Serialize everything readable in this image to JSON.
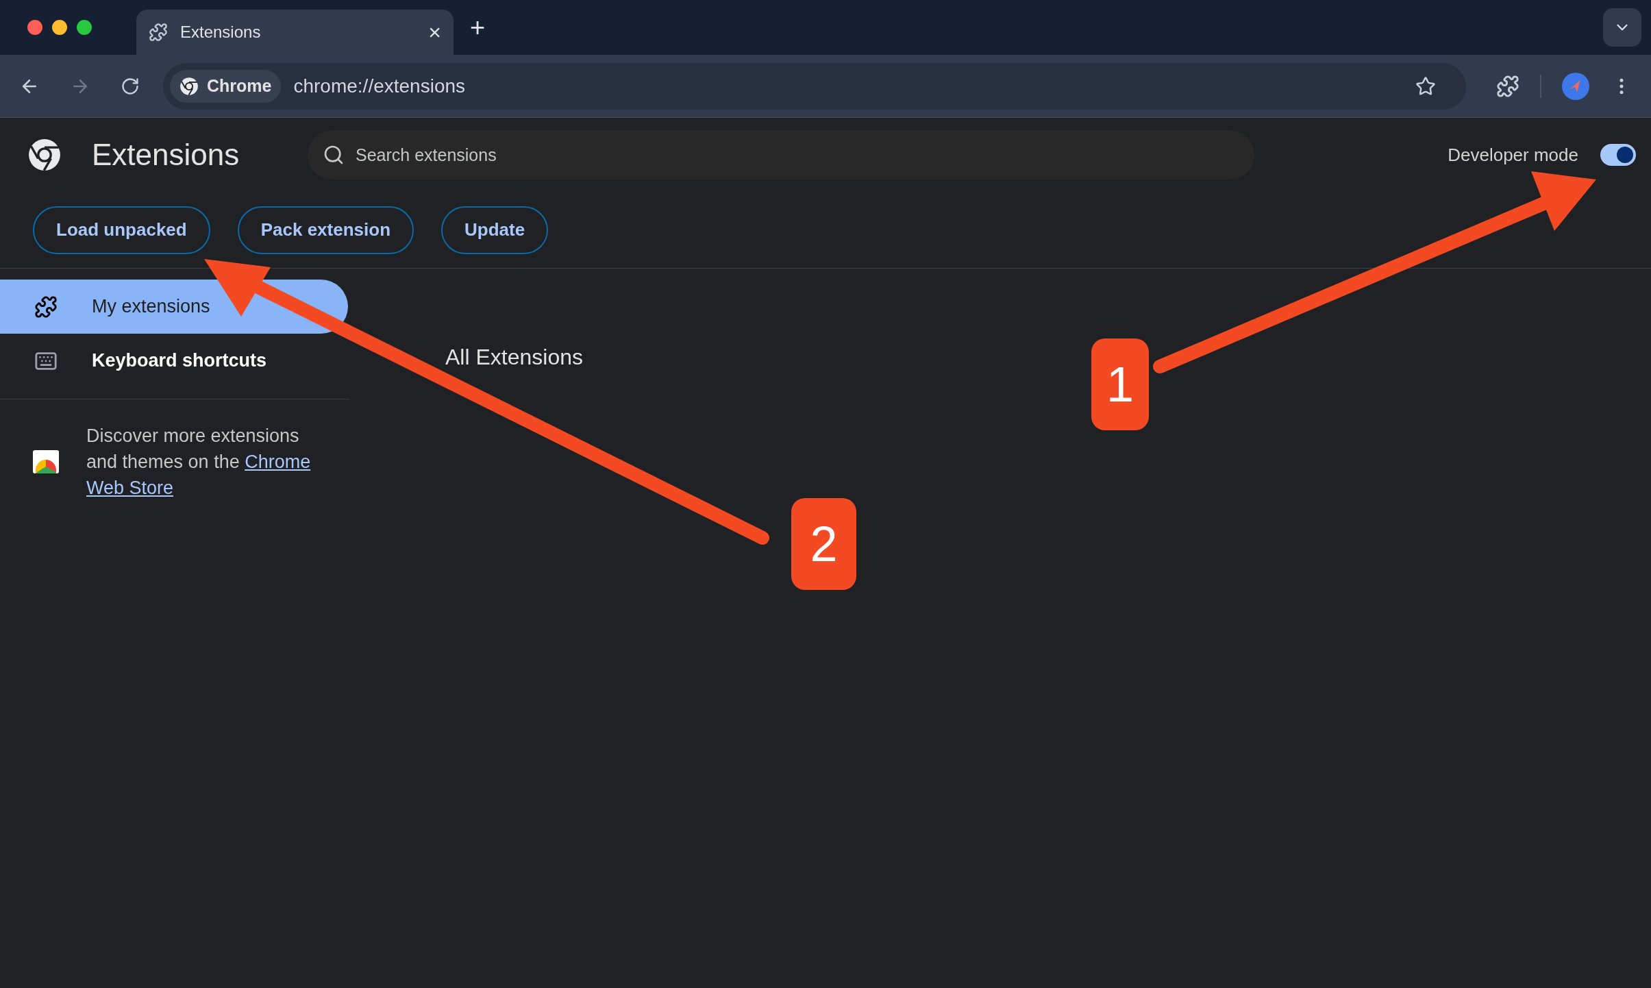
{
  "tab": {
    "title": "Extensions",
    "close": "×",
    "new_tab": "+"
  },
  "address_bar": {
    "chip": "Chrome",
    "url": "chrome://extensions"
  },
  "header": {
    "title": "Extensions",
    "search": {
      "placeholder": "Search extensions"
    },
    "developer_mode": {
      "label": "Developer mode",
      "on": true
    }
  },
  "actions": [
    "Load unpacked",
    "Pack extension",
    "Update"
  ],
  "sidebar": {
    "items": [
      {
        "label": "My extensions",
        "kind": "puzzle",
        "selected": true
      },
      {
        "label": "Keyboard shortcuts",
        "kind": "keyboard",
        "selected": false
      }
    ],
    "promo": {
      "text": "Discover more extensions and themes on the ",
      "link_lines": [
        "Chrome",
        "Web Store"
      ]
    }
  },
  "main": {
    "heading": "All Extensions"
  },
  "annotations": [
    {
      "label": "1"
    },
    {
      "label": "2"
    }
  ]
}
